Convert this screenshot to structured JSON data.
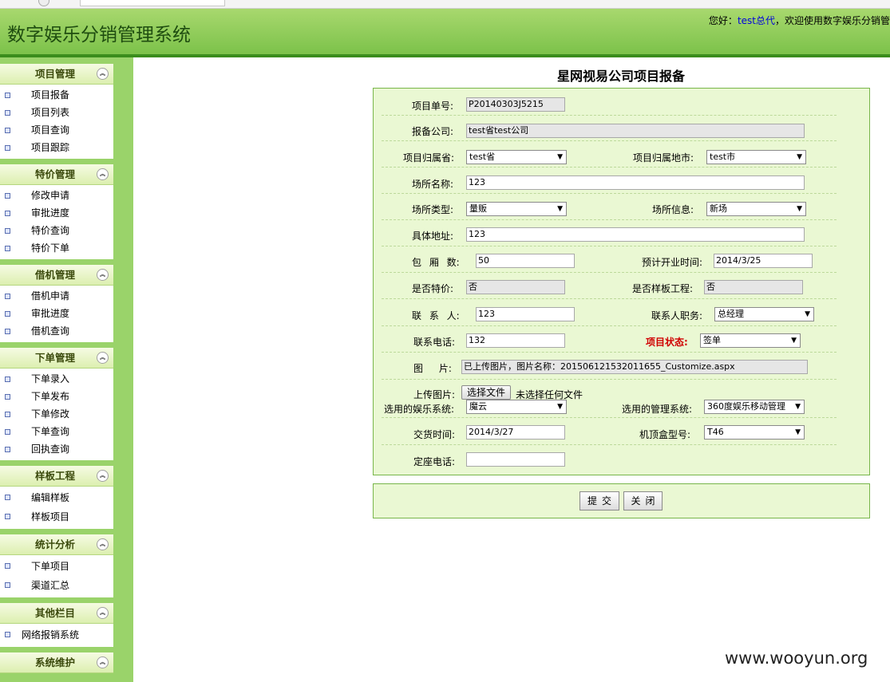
{
  "header": {
    "title": "数字娱乐分销管理系统",
    "welcome_prefix": "您好：",
    "welcome_user": "test总代",
    "welcome_suffix": "，欢迎使用数字娱乐分销管"
  },
  "sidebar": {
    "sections": [
      {
        "title": "项目管理",
        "items": [
          "项目报备",
          "项目列表",
          "项目查询",
          "项目跟踪"
        ]
      },
      {
        "title": "特价管理",
        "items": [
          "修改申请",
          "审批进度",
          "特价查询",
          "特价下单"
        ]
      },
      {
        "title": "借机管理",
        "items": [
          "借机申请",
          "审批进度",
          "借机查询"
        ]
      },
      {
        "title": "下单管理",
        "items": [
          "下单录入",
          "下单发布",
          "下单修改",
          "下单查询",
          "回执查询"
        ]
      },
      {
        "title": "样板工程",
        "items": [
          "编辑样板",
          "样板项目"
        ]
      },
      {
        "title": "统计分析",
        "items": [
          "下单项目",
          "渠道汇总"
        ]
      },
      {
        "title": "其他栏目",
        "items": [
          "网络报销系统"
        ]
      },
      {
        "title": "系统维护",
        "items": []
      }
    ]
  },
  "form": {
    "title": "星网视易公司项目报备",
    "project_no": {
      "label": "项目单号:",
      "value": "P20140303J5215"
    },
    "company": {
      "label": "报备公司:",
      "value": "test省test公司"
    },
    "province": {
      "label": "项目归属省:",
      "value": "test省"
    },
    "city": {
      "label": "项目归属地市:",
      "value": "test市"
    },
    "venue_name": {
      "label": "场所名称:",
      "value": "123"
    },
    "venue_type": {
      "label": "场所类型:",
      "value": "量贩"
    },
    "venue_info": {
      "label": "场所信息:",
      "value": "新场"
    },
    "address": {
      "label": "具体地址:",
      "value": "123"
    },
    "rooms": {
      "label": "包 厢 数:",
      "value": "50"
    },
    "open_date": {
      "label": "预计开业时间:",
      "value": "2014/3/25"
    },
    "special_price": {
      "label": "是否特价:",
      "value": "否"
    },
    "sample_project": {
      "label": "是否样板工程:",
      "value": "否"
    },
    "contact": {
      "label": "联 系 人:",
      "value": "123"
    },
    "contact_title": {
      "label": "联系人职务:",
      "value": "总经理"
    },
    "phone": {
      "label": "联系电话:",
      "value": "132"
    },
    "status": {
      "label": "项目状态:",
      "value": "签单"
    },
    "image": {
      "label": "图 片:",
      "value": "已上传图片，图片名称：201506121532011655_Customize.aspx"
    },
    "upload": {
      "label": "上传图片:",
      "button": "选择文件",
      "status": "未选择任何文件"
    },
    "ent_system": {
      "label": "选用的娱乐系统:",
      "value": "魔云"
    },
    "mgmt_system": {
      "label": "选用的管理系统:",
      "value": "360度娱乐移动管理"
    },
    "delivery": {
      "label": "交货时间:",
      "value": "2014/3/27"
    },
    "stb_model": {
      "label": "机顶盒型号:",
      "value": "T46"
    },
    "landline": {
      "label": "定座电话:",
      "value": ""
    }
  },
  "buttons": {
    "submit": "提交",
    "close": "关闭"
  },
  "watermark": "www.wooyun.org"
}
